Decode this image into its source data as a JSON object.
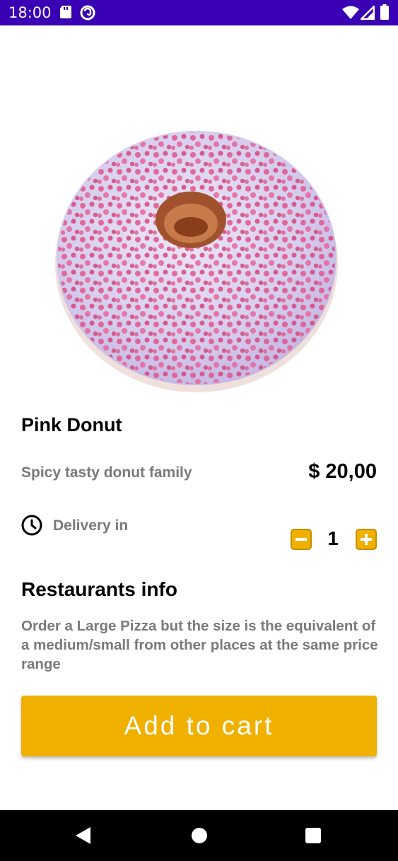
{
  "status_bar": {
    "time": "18:00",
    "icons": [
      "sd-card-icon",
      "do-not-disturb-icon",
      "wifi-icon",
      "signal-icon",
      "battery-icon"
    ]
  },
  "product": {
    "image": "pink-donut-image",
    "name": "Pink Donut",
    "subtitle": "Spicy tasty donut family",
    "price": "$ 20,00",
    "delivery_label": "Delivery in",
    "quantity": "1"
  },
  "restaurant": {
    "title": "Restaurants info",
    "description": "Order a Large Pizza but the size is the equivalent of a medium/small from other places at the same price range"
  },
  "actions": {
    "add_to_cart": "Add to cart"
  },
  "nav_bar": {
    "icons": [
      "back-icon",
      "home-icon",
      "recents-icon"
    ]
  },
  "colors": {
    "status_bar": "#3a00b4",
    "accent": "#f0b000",
    "text_primary": "#000000",
    "text_secondary": "#7a7a7a"
  }
}
